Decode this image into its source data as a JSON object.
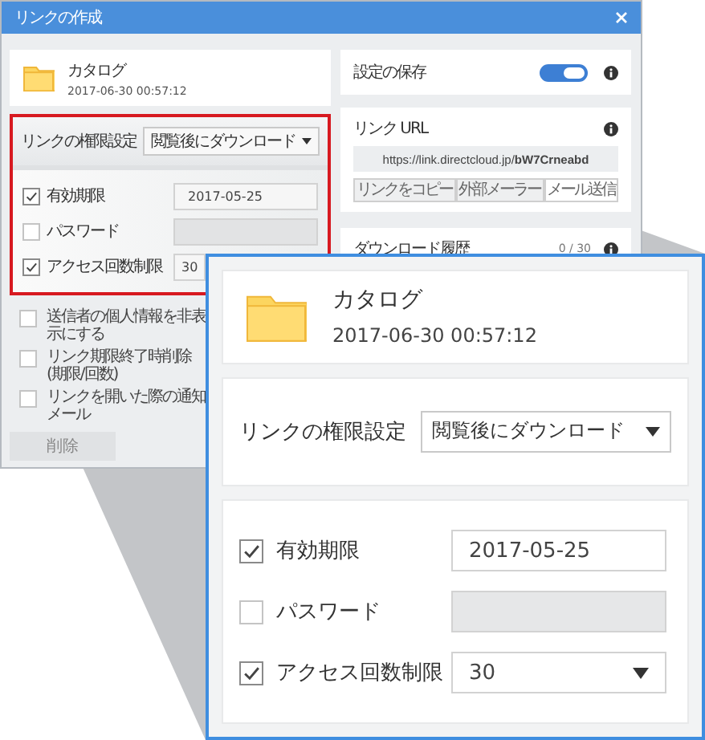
{
  "window": {
    "title": "リンクの作成"
  },
  "file": {
    "name": "カタログ",
    "date": "2017-06-30 00:57:12"
  },
  "permission": {
    "label": "リンクの権限設定",
    "value": "閲覧後にダウンロード"
  },
  "options": [
    {
      "kind": "date",
      "label": "有効期限",
      "checked": true,
      "value": "2017-05-25",
      "disabled": false
    },
    {
      "kind": "text",
      "label": "パスワード",
      "checked": false,
      "disabled": true
    },
    {
      "kind": "select",
      "label": "アクセス回数制限",
      "checked": true,
      "value": "30",
      "disabled": false
    }
  ],
  "extra_options": [
    {
      "label": "送信者の個人情報を非表示にする",
      "checked": false
    },
    {
      "label": "リンク期限終了時削除(期限/回数)",
      "checked": false
    },
    {
      "label": "リンクを開いた際の通知メール",
      "checked": false
    }
  ],
  "buttons": [
    {
      "label": "削除"
    }
  ],
  "save_settings": {
    "label": "設定の保存",
    "on": true
  },
  "link_url": {
    "label": "リンク URL",
    "url": "https://link.directcloud.jp/**bW7Crneabd**",
    "buttons": [
      {
        "label": "リンクをコピー",
        "selected": false
      },
      {
        "label": "外部メーラー",
        "selected": false
      },
      {
        "label": "メール送信",
        "selected": true
      }
    ]
  },
  "download_history": {
    "label": "ダウンロード履歴",
    "count": "0 / 30"
  },
  "zoom": {
    "file": {
      "name": "カタログ",
      "date": "2017-06-30 00:57:12"
    },
    "permission": {
      "label": "リンクの権限設定",
      "value": "閲覧後にダウンロード"
    },
    "options": [
      {
        "kind": "date",
        "label": "有効期限",
        "checked": true,
        "value": "2017-05-25",
        "disabled": false
      },
      {
        "kind": "text",
        "label": "パスワード",
        "checked": false,
        "disabled": true
      },
      {
        "kind": "select",
        "label": "アクセス回数制限",
        "checked": true,
        "value": "30",
        "disabled": false
      }
    ]
  }
}
